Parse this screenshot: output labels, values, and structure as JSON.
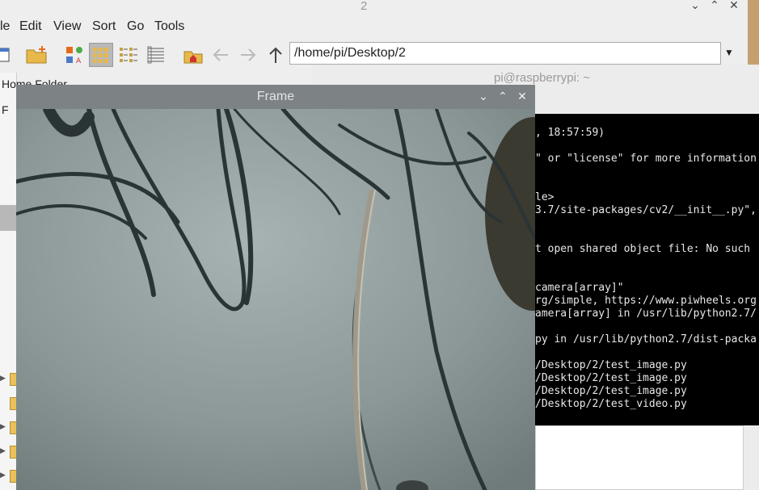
{
  "file_manager": {
    "title": "2",
    "window_controls": {
      "minimize": "⌄",
      "maximize": "⌃",
      "close": "✕"
    },
    "menu": [
      "le",
      "Edit",
      "View",
      "Sort",
      "Go",
      "Tools"
    ],
    "toolbar_icons": [
      "new-window-icon",
      "new-folder-icon",
      "show-icons-view-icon",
      "thumbnail-view-icon",
      "compact-view-icon",
      "list-view-icon",
      "home-icon",
      "back-arrow-icon",
      "forward-arrow-icon",
      "up-arrow-icon"
    ],
    "path": "/home/pi/Desktop/2",
    "sidebar": {
      "home_label": "Home Folder",
      "f_label": "F"
    }
  },
  "terminal": {
    "title": "pi@raspberrypi: ~",
    "lines": [
      ", 18:57:59)",
      "\" or \"license\" for more information",
      "le>",
      "3.7/site-packages/cv2/__init__.py\",",
      "t open shared object file: No such",
      "camera[array]\"",
      "rg/simple, https://www.piwheels.org",
      "amera[array] in /usr/lib/python2.7/",
      "py in /usr/lib/python2.7/dist-packa",
      "/Desktop/2/test_image.py",
      "/Desktop/2/test_image.py",
      "/Desktop/2/test_image.py",
      "/Desktop/2/test_video.py"
    ]
  },
  "frame": {
    "title": "Frame",
    "controls": {
      "minimize": "⌄",
      "maximize": "⌃",
      "close": "✕"
    }
  }
}
